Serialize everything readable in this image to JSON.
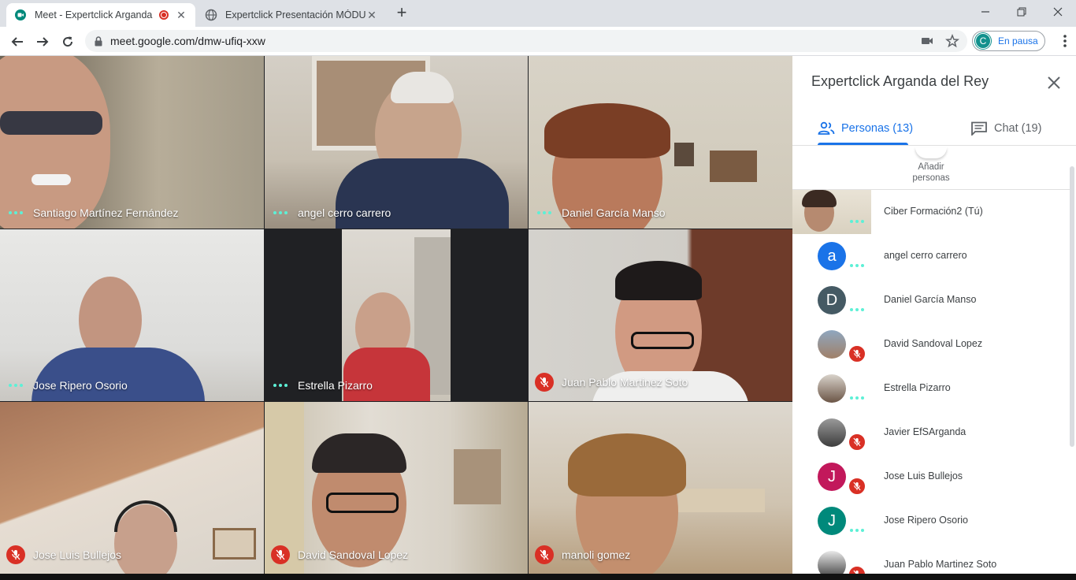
{
  "browser": {
    "tabs": [
      {
        "title": "Meet - Expertclick Arganda d",
        "active": true,
        "recording": true
      },
      {
        "title": "Expertclick Presentación MÓDULO",
        "active": false
      }
    ],
    "url": "meet.google.com/dmw-ufiq-xxw",
    "profile": {
      "initial": "C",
      "status": "En pausa"
    },
    "accent": "#1a73e8"
  },
  "grid": {
    "tiles": [
      {
        "name": "Santiago Martínez Fernández",
        "state": "speaking"
      },
      {
        "name": "angel cerro carrero",
        "state": "speaking"
      },
      {
        "name": "Daniel García Manso",
        "state": "speaking"
      },
      {
        "name": "Jose Ripero Osorio",
        "state": "speaking"
      },
      {
        "name": "Estrella Pizarro",
        "state": "speaking"
      },
      {
        "name": "Juan Pablo Martinez Soto",
        "state": "muted"
      },
      {
        "name": "Jose Luis Bullejos",
        "state": "muted"
      },
      {
        "name": "David Sandoval Lopez",
        "state": "muted"
      },
      {
        "name": "manoli gomez",
        "state": "muted"
      }
    ]
  },
  "panel": {
    "title": "Expertclick Arganda del Rey",
    "tabs": {
      "people": "Personas (13)",
      "chat": "Chat (19)"
    },
    "add_people_line1": "Añadir",
    "add_people_line2": "personas",
    "people": [
      {
        "name": "Ciber Formación2 (Tú)",
        "avatar": "photo",
        "status": "on"
      },
      {
        "name": "angel cerro carrero",
        "avatar": "a",
        "color": "#1a73e8",
        "status": "on"
      },
      {
        "name": "Daniel García Manso",
        "avatar": "D",
        "color": "#455a64",
        "status": "on"
      },
      {
        "name": "David Sandoval Lopez",
        "avatar": "photo",
        "status": "muted"
      },
      {
        "name": "Estrella Pizarro",
        "avatar": "photo",
        "status": "on"
      },
      {
        "name": "Javier EfSArganda",
        "avatar": "photo",
        "status": "muted"
      },
      {
        "name": "Jose Luis Bullejos",
        "avatar": "J",
        "color": "#c2185b",
        "status": "muted"
      },
      {
        "name": "Jose Ripero Osorio",
        "avatar": "J",
        "color": "#00897b",
        "status": "on"
      },
      {
        "name": "Juan Pablo Martinez Soto",
        "avatar": "photo",
        "status": "muted"
      }
    ]
  },
  "mute_color": "#d93025",
  "speaking_color": "#5df0d6"
}
